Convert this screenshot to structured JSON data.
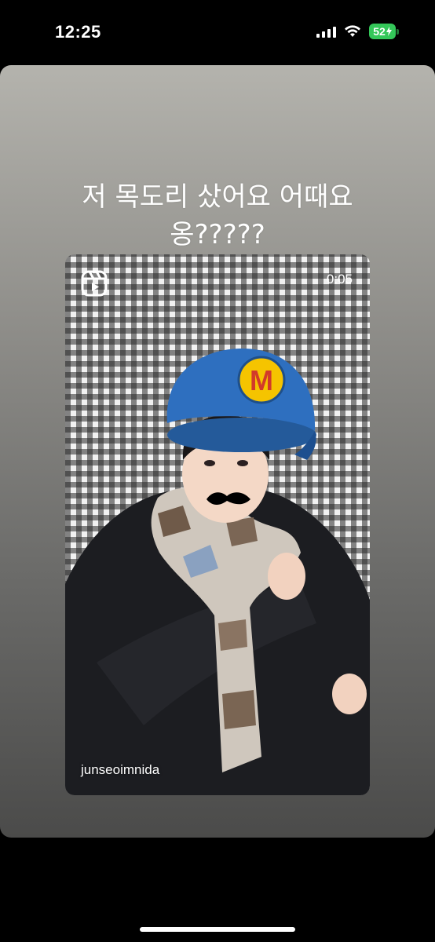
{
  "status_bar": {
    "time": "12:25",
    "battery_level": "52",
    "icons": [
      "cellular-signal-icon",
      "wifi-icon",
      "battery-charging-icon"
    ]
  },
  "story": {
    "caption_line1": "저 목도리 샀어요 어때요",
    "caption_line2": "옹?????",
    "reel": {
      "icon": "reels-icon",
      "duration": "0:05",
      "username": "junseoimnida",
      "cap_emblem_letter": "M"
    }
  },
  "colors": {
    "battery": "#34c759",
    "cap_blue": "#2e6fbf",
    "emblem_yellow": "#f5c400",
    "emblem_red": "#d23a2a"
  }
}
